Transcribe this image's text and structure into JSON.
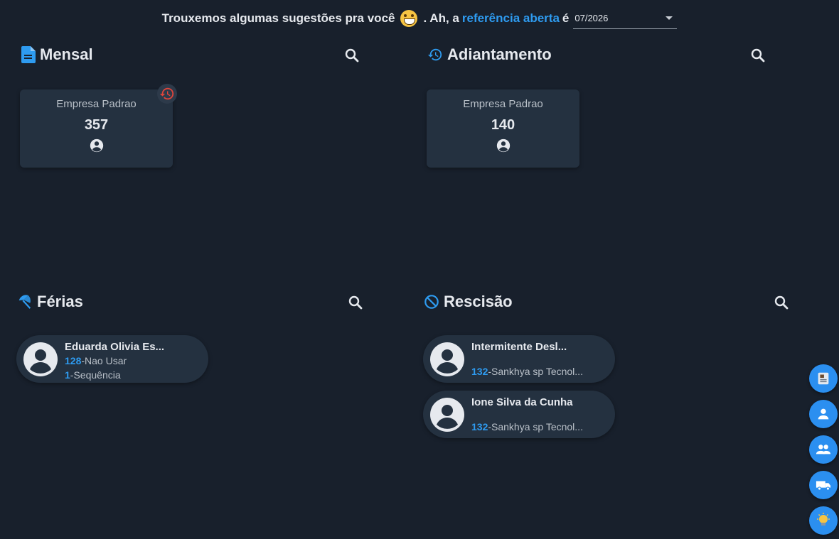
{
  "header": {
    "text_before": "Trouxemos algumas sugestões pra você",
    "text_middle": ". Ah, a",
    "link_text": "referência aberta",
    "text_after": "é",
    "reference_value": "07/2026"
  },
  "sections": {
    "mensal": {
      "title": "Mensal",
      "company": {
        "name": "Empresa Padrao",
        "count": "357"
      }
    },
    "adiantamento": {
      "title": "Adiantamento",
      "company": {
        "name": "Empresa Padrao",
        "count": "140"
      }
    },
    "ferias": {
      "title": "Férias",
      "people": [
        {
          "name": "Eduarda Olivia Es...",
          "line1_code": "128",
          "line1_text": "-Nao Usar",
          "line2_code": "1",
          "line2_text": "-Sequência"
        }
      ]
    },
    "rescisao": {
      "title": "Rescisão",
      "people": [
        {
          "name": "Intermitente Desl...",
          "code": "132",
          "text": "-Sankhya sp Tecnol..."
        },
        {
          "name": "Ione Silva da Cunha",
          "code": "132",
          "text": "-Sankhya sp Tecnol..."
        }
      ]
    }
  },
  "colors": {
    "background": "#18202c",
    "card": "#243140",
    "accent": "#2e9bf0",
    "history_red": "#e0453b"
  },
  "side_actions": [
    "document-icon",
    "person-icon",
    "people-icon",
    "truck-icon",
    "lightbulb-icon"
  ]
}
